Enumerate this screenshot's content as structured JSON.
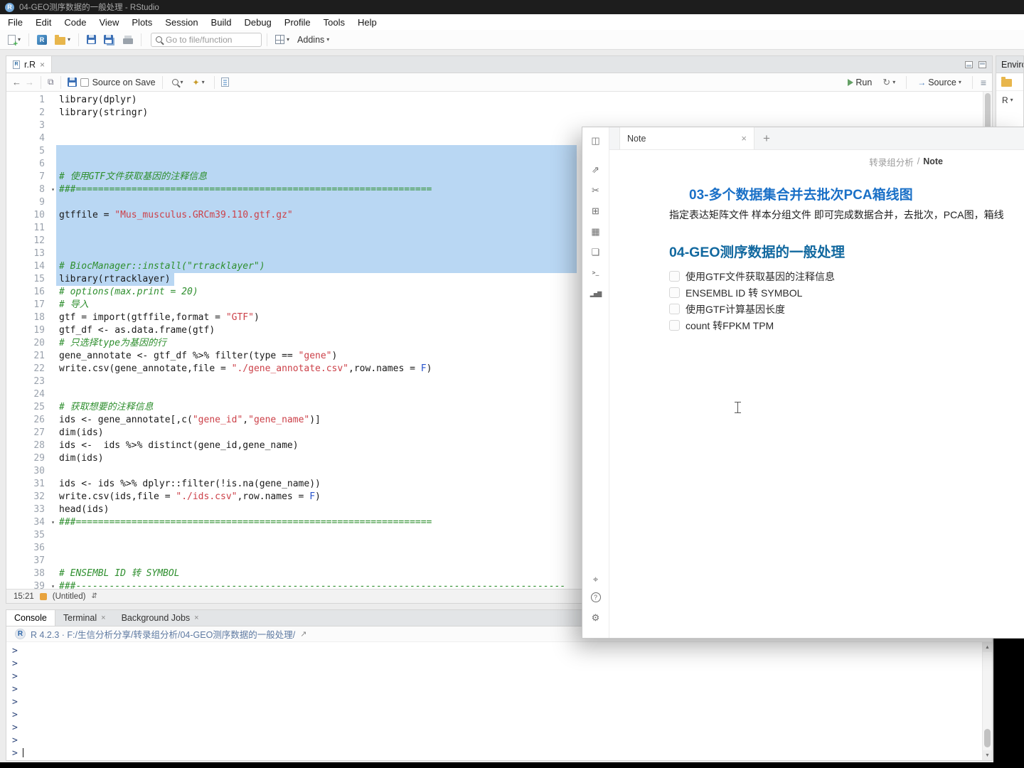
{
  "window": {
    "title": "04-GEO测序数据的一般处理 - RStudio"
  },
  "icons": {
    "r_letter": "R"
  },
  "menu_bar": {
    "items": [
      "File",
      "Edit",
      "Code",
      "View",
      "Plots",
      "Session",
      "Build",
      "Debug",
      "Profile",
      "Tools",
      "Help"
    ]
  },
  "main_toolbar": {
    "goto_placeholder": "Go to file/function",
    "addins_label": "Addins"
  },
  "source_pane": {
    "tab_label": "r.R",
    "toolbar": {
      "source_on_save": "Source on Save",
      "run_label": "Run",
      "source_label": "Source"
    },
    "status_bar": {
      "cursor_position": "15:21",
      "section": "(Untitled)"
    },
    "fold_lines": [
      8,
      34,
      39
    ],
    "code_lines": [
      [
        [
          "p",
          "library(dplyr)"
        ]
      ],
      [
        [
          "p",
          "library(stringr)"
        ]
      ],
      [],
      [],
      [],
      [],
      [
        [
          "c",
          "# 使用GTF文件获取基因的注释信息"
        ]
      ],
      [
        [
          "c",
          "###================================================================"
        ]
      ],
      [],
      [
        [
          "p",
          "gtffile = "
        ],
        [
          "s",
          "\"Mus_musculus.GRCm39.110.gtf.gz\""
        ]
      ],
      [],
      [],
      [],
      [
        [
          "c",
          "# BiocManager::install(\"rtracklayer\")"
        ]
      ],
      [
        [
          "p",
          "library(rtracklayer)"
        ]
      ],
      [
        [
          "c",
          "# options(max.print = 20)"
        ]
      ],
      [
        [
          "c",
          "# 导入"
        ]
      ],
      [
        [
          "p",
          "gtf = import(gtffile,format = "
        ],
        [
          "s",
          "\"GTF\""
        ],
        [
          "p",
          ")"
        ]
      ],
      [
        [
          "p",
          "gtf_df <- as.data.frame(gtf)"
        ]
      ],
      [
        [
          "c",
          "# 只选择type为基因的行"
        ]
      ],
      [
        [
          "p",
          "gene_annotate <- gtf_df %>% filter(type == "
        ],
        [
          "s",
          "\"gene\""
        ],
        [
          "p",
          ")"
        ]
      ],
      [
        [
          "p",
          "write.csv(gene_annotate,file = "
        ],
        [
          "s",
          "\"./gene_annotate.csv\""
        ],
        [
          "p",
          ",row.names = "
        ],
        [
          "k",
          "F"
        ],
        [
          "p",
          ")"
        ]
      ],
      [],
      [],
      [
        [
          "c",
          "# 获取想要的注释信息"
        ]
      ],
      [
        [
          "p",
          "ids <- gene_annotate[,c("
        ],
        [
          "s",
          "\"gene_id\""
        ],
        [
          "p",
          ","
        ],
        [
          "s",
          "\"gene_name\""
        ],
        [
          "p",
          ")]"
        ]
      ],
      [
        [
          "p",
          "dim(ids)"
        ]
      ],
      [
        [
          "p",
          "ids <-  ids %>% distinct(gene_id,gene_name)"
        ]
      ],
      [
        [
          "p",
          "dim(ids)"
        ]
      ],
      [],
      [
        [
          "p",
          "ids <- ids %>% dplyr::filter(!is.na(gene_name))"
        ]
      ],
      [
        [
          "p",
          "write.csv(ids,file = "
        ],
        [
          "s",
          "\"./ids.csv\""
        ],
        [
          "p",
          ",row.names = "
        ],
        [
          "k",
          "F"
        ],
        [
          "p",
          ")"
        ]
      ],
      [
        [
          "p",
          "head(ids)"
        ]
      ],
      [
        [
          "c",
          "###================================================================"
        ]
      ],
      [],
      [],
      [],
      [
        [
          "c",
          "# ENSEMBL ID 转 SYMBOL"
        ]
      ],
      [
        [
          "c",
          "###----------------------------------------------------------------------------------------"
        ]
      ]
    ]
  },
  "environment_pane": {
    "title": "Environment",
    "r_version_label": "R"
  },
  "console_pane": {
    "tabs": [
      {
        "label": "Console",
        "active": true,
        "closable": false
      },
      {
        "label": "Terminal",
        "active": false,
        "closable": true
      },
      {
        "label": "Background Jobs",
        "active": false,
        "closable": true
      }
    ],
    "banner": "R 4.2.3 · F:/生信分析分享/转录组分析/04-GEO测序数据的一般处理/",
    "prompts": [
      ">",
      ">",
      ">",
      ">",
      ">",
      ">",
      ">",
      ">",
      ">"
    ]
  },
  "note_window": {
    "tab_label": "Note",
    "new_tab_label": "+",
    "breadcrumb": {
      "parent": "转录组分析",
      "separator": "/",
      "current": "Note"
    },
    "rail_top_icons": [
      {
        "name": "sidebar-toggle-icon",
        "glyph": "◫"
      },
      {
        "name": "share-icon",
        "glyph": "⇗"
      },
      {
        "name": "scissors-icon",
        "glyph": "✂"
      },
      {
        "name": "apps-grid-icon",
        "glyph": "⊞"
      },
      {
        "name": "calendar-icon",
        "glyph": "▦"
      },
      {
        "name": "copy-icon",
        "glyph": "❏"
      },
      {
        "name": "terminal-icon",
        "glyph": ">_"
      },
      {
        "name": "chart-icon",
        "glyph": "▂▅▇"
      }
    ],
    "rail_bottom_icons": [
      {
        "name": "location-icon",
        "glyph": "⌖"
      },
      {
        "name": "help-icon",
        "glyph": "?"
      },
      {
        "name": "settings-icon",
        "glyph": "⚙"
      }
    ],
    "sections": [
      {
        "heading": "03-多个数据集合并去批次PCA箱线图",
        "heading_color": "#1a70c7",
        "paragraph": "指定表达矩阵文件 样本分组文件 即可完成数据合并，去批次，PCA图，箱线"
      },
      {
        "heading": "04-GEO测序数据的一般处理",
        "heading_color": "#11689f",
        "checklist": [
          "使用GTF文件获取基因的注释信息",
          "ENSEMBL ID 转 SYMBOL",
          "使用GTF计算基因长度",
          "count 转FPKM TPM"
        ]
      }
    ]
  },
  "colors": {
    "selection": "#b9d7f3",
    "comment": "#2f8f2f",
    "string": "#cc4149",
    "constant": "#2753cc",
    "console_prompt": "#30487c"
  }
}
